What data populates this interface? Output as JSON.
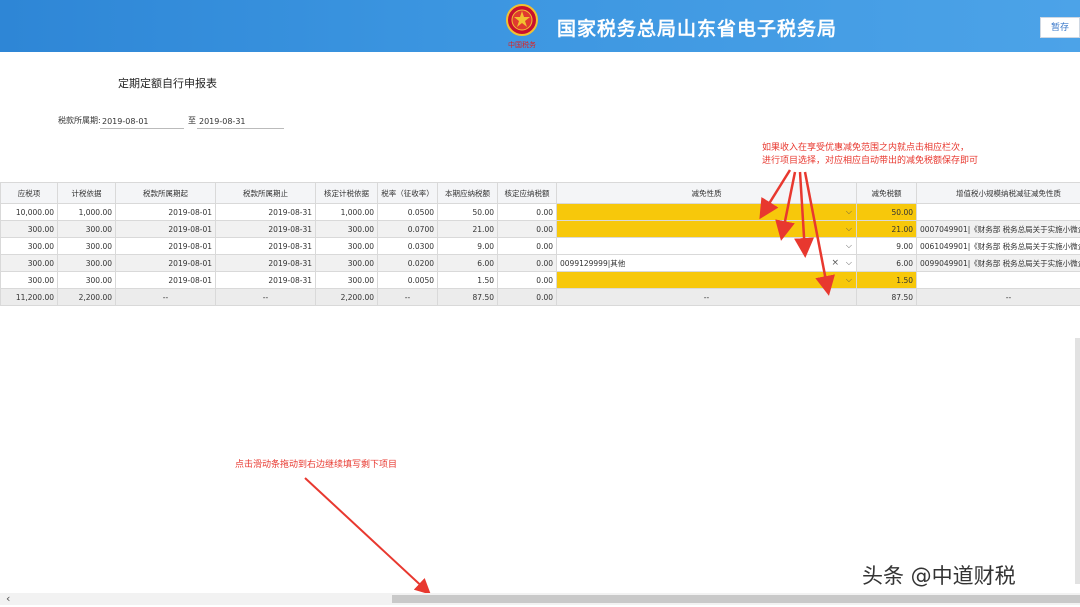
{
  "header": {
    "site_title": "国家税务总局山东省电子税务局",
    "emblem_caption": "中国税务",
    "save_button": "暂存",
    "colors": {
      "bar": "#3b95e0"
    }
  },
  "form": {
    "title": "定期定额自行申报表",
    "period_label": "税款所属期:",
    "period_start": "2019-08-01",
    "period_to": "至",
    "period_end": "2019-08-31"
  },
  "annotations": {
    "top_line1": "如果收入在享受优惠减免范围之内就点击相应栏次，",
    "top_line2": "进行项目选择，对应相应自动带出的减免税额保存即可",
    "bottom": "点击滑动条拖动到右边继续填写剩下项目"
  },
  "table": {
    "headers": [
      "应税项",
      "计税依据",
      "税款所属期起",
      "税款所属期止",
      "核定计税依据",
      "税率（征收率）",
      "本期应纳税额",
      "核定应纳税额",
      "减免性质",
      "减免税额",
      "增值税小规模纳税减征减免性质"
    ],
    "rows": [
      {
        "c0": "10,000.00",
        "c1": "1,000.00",
        "c2": "2019-08-01",
        "c3": "2019-08-31",
        "c4": "1,000.00",
        "c5": "0.0500",
        "c6": "50.00",
        "c7": "0.00",
        "c8": "",
        "c9": "50.00",
        "c10": ""
      },
      {
        "c0": "300.00",
        "c1": "300.00",
        "c2": "2019-08-01",
        "c3": "2019-08-31",
        "c4": "300.00",
        "c5": "0.0700",
        "c6": "21.00",
        "c7": "0.00",
        "c8": "",
        "c9": "21.00",
        "c10": "0007049901|《财务部 税务总局关于实施小微企"
      },
      {
        "c0": "300.00",
        "c1": "300.00",
        "c2": "2019-08-01",
        "c3": "2019-08-31",
        "c4": "300.00",
        "c5": "0.0300",
        "c6": "9.00",
        "c7": "0.00",
        "c8": "",
        "c9": "9.00",
        "c10": "0061049901|《财务部 税务总局关于实施小微企"
      },
      {
        "c0": "300.00",
        "c1": "300.00",
        "c2": "2019-08-01",
        "c3": "2019-08-31",
        "c4": "300.00",
        "c5": "0.0200",
        "c6": "6.00",
        "c7": "0.00",
        "c8": "0099129999|其他",
        "c9": "6.00",
        "c10": "0099049901|《财务部 税务总局关于实施小微企"
      },
      {
        "c0": "300.00",
        "c1": "300.00",
        "c2": "2019-08-01",
        "c3": "2019-08-31",
        "c4": "300.00",
        "c5": "0.0050",
        "c6": "1.50",
        "c7": "0.00",
        "c8": "",
        "c9": "1.50",
        "c10": ""
      }
    ],
    "total": {
      "c0": "11,200.00",
      "c1": "2,200.00",
      "c2": "--",
      "c3": "--",
      "c4": "2,200.00",
      "c5": "--",
      "c6": "87.50",
      "c7": "0.00",
      "c8": "--",
      "c9": "87.50",
      "c10": "--"
    },
    "clear_symbol": "×",
    "dropdown_symbol": "⌵",
    "highlight_color": "#f7c80b"
  },
  "scrollbar": {
    "left_arrow": "‹"
  },
  "watermark": "头条 @中道财税"
}
